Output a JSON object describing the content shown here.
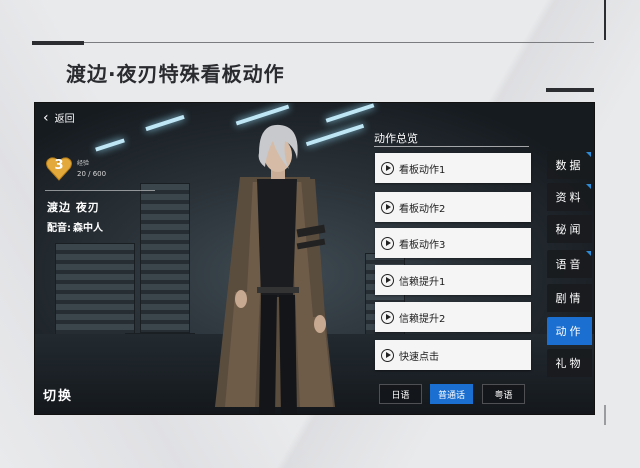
{
  "page": {
    "title": "渡边·夜刃特殊看板动作"
  },
  "game": {
    "back_label": "返回",
    "level": "3",
    "exp_label": "经验",
    "exp_value": "20 / 600",
    "character_name": "渡边 夜刃",
    "cv_label": "配音:",
    "cv_name": "森中人",
    "switch_label": "切换",
    "actions_title": "动作总览",
    "actions": [
      {
        "label": "看板动作1"
      },
      {
        "label": "看板动作2"
      },
      {
        "label": "看板动作3"
      },
      {
        "label": "信赖提升1"
      },
      {
        "label": "信赖提升2"
      },
      {
        "label": "快速点击"
      }
    ],
    "tabs": [
      {
        "label": "数据",
        "active": false
      },
      {
        "label": "资料",
        "active": false
      },
      {
        "label": "秘闻",
        "active": false
      },
      {
        "label": "语音",
        "active": false
      },
      {
        "label": "剧情",
        "active": false
      },
      {
        "label": "动作",
        "active": true
      },
      {
        "label": "礼物",
        "active": false
      }
    ],
    "languages": [
      {
        "label": "日语",
        "active": false
      },
      {
        "label": "普通话",
        "active": true
      },
      {
        "label": "粤语",
        "active": false
      }
    ],
    "colors": {
      "accent": "#1a6fd0",
      "level_badge": "#e3a93a"
    }
  }
}
